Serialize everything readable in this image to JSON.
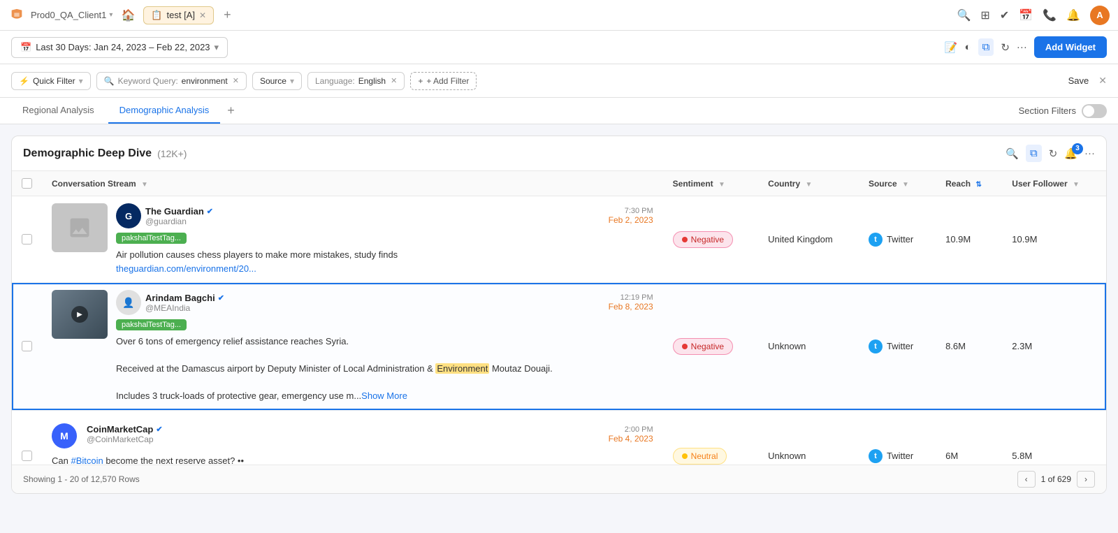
{
  "app": {
    "workspace": "Prod0_QA_Client1",
    "tab_name": "test [A]",
    "tab_icon": "📋"
  },
  "topbar": {
    "icons": [
      "search",
      "grid",
      "check",
      "calendar",
      "phone",
      "bell"
    ],
    "avatar_initial": "A"
  },
  "filterbar": {
    "quick_filter_label": "Quick Filter",
    "keyword_label": "Keyword Query:",
    "keyword_value": "environment",
    "source_label": "Source",
    "language_label": "Language:",
    "language_value": "English",
    "add_filter_label": "+ Add Filter",
    "save_label": "Save"
  },
  "datebar": {
    "date_range": "Last 30 Days: Jan 24, 2023 – Feb 22, 2023",
    "add_widget_label": "Add Widget"
  },
  "tabs": {
    "items": [
      {
        "id": "regional",
        "label": "Regional Analysis",
        "active": false
      },
      {
        "id": "demographic",
        "label": "Demographic Analysis",
        "active": true
      }
    ],
    "section_filters_label": "Section Filters"
  },
  "widget": {
    "title": "Demographic Deep Dive",
    "count": "(12K+)",
    "columns": [
      {
        "id": "conversation",
        "label": "Conversation Stream",
        "sortable": true
      },
      {
        "id": "sentiment",
        "label": "Sentiment",
        "sortable": true
      },
      {
        "id": "country",
        "label": "Country",
        "sortable": true
      },
      {
        "id": "source",
        "label": "Source",
        "sortable": true
      },
      {
        "id": "reach",
        "label": "Reach",
        "sortable": true
      },
      {
        "id": "user_follower",
        "label": "User Follower",
        "sortable": true
      }
    ],
    "rows": [
      {
        "id": "row1",
        "author": "The Guardian",
        "handle": "@guardian",
        "verified": true,
        "time": "7:30 PM",
        "date": "Feb 2, 2023",
        "tag": "pakshalTestTag...",
        "text": "Air pollution causes chess players to make more mistakes, study finds",
        "link": "theguardian.com/environment/20...",
        "sentiment": "Negative",
        "sentiment_type": "negative",
        "country": "United Kingdom",
        "source": "Twitter",
        "reach": "10.9M",
        "user_follower": "10.9M",
        "selected": false
      },
      {
        "id": "row2",
        "author": "Arindam Bagchi",
        "handle": "@MEAIndia",
        "verified": true,
        "time": "12:19 PM",
        "date": "Feb 8, 2023",
        "tag": "pakshalTestTag...",
        "text": "Over 6 tons of emergency relief assistance reaches Syria.\n\nReceived at the Damascus airport by Deputy Minister of Local Administration & Environment Moutaz Douaji.\n\nIncludes 3 truck-loads of protective gear, emergency use m...",
        "show_more": "Show More",
        "highlight_word": "Environment",
        "sentiment": "Negative",
        "sentiment_type": "negative",
        "country": "Unknown",
        "source": "Twitter",
        "reach": "8.6M",
        "user_follower": "2.3M",
        "selected": true
      },
      {
        "id": "row3",
        "author": "CoinMarketCap",
        "handle": "@CoinMarketCap",
        "verified": true,
        "time": "2:00 PM",
        "date": "Feb 4, 2023",
        "tag": "",
        "text": "Can #Bitcoin become the next reserve asset? ••\n\n$BTC finds itself for the first time in an environment of high inflation and great economic uncertainty",
        "hashtag": "#Bitcoin",
        "highlight_word": "environment",
        "sentiment": "Neutral",
        "sentiment_type": "neutral",
        "country": "Unknown",
        "source": "Twitter",
        "reach": "6M",
        "user_follower": "5.8M",
        "selected": false
      }
    ],
    "footer": {
      "showing": "Showing 1 - 20 of 12,570 Rows",
      "page_info": "1 of 629",
      "prev_label": "‹",
      "next_label": "›"
    },
    "notification_count": "3"
  }
}
